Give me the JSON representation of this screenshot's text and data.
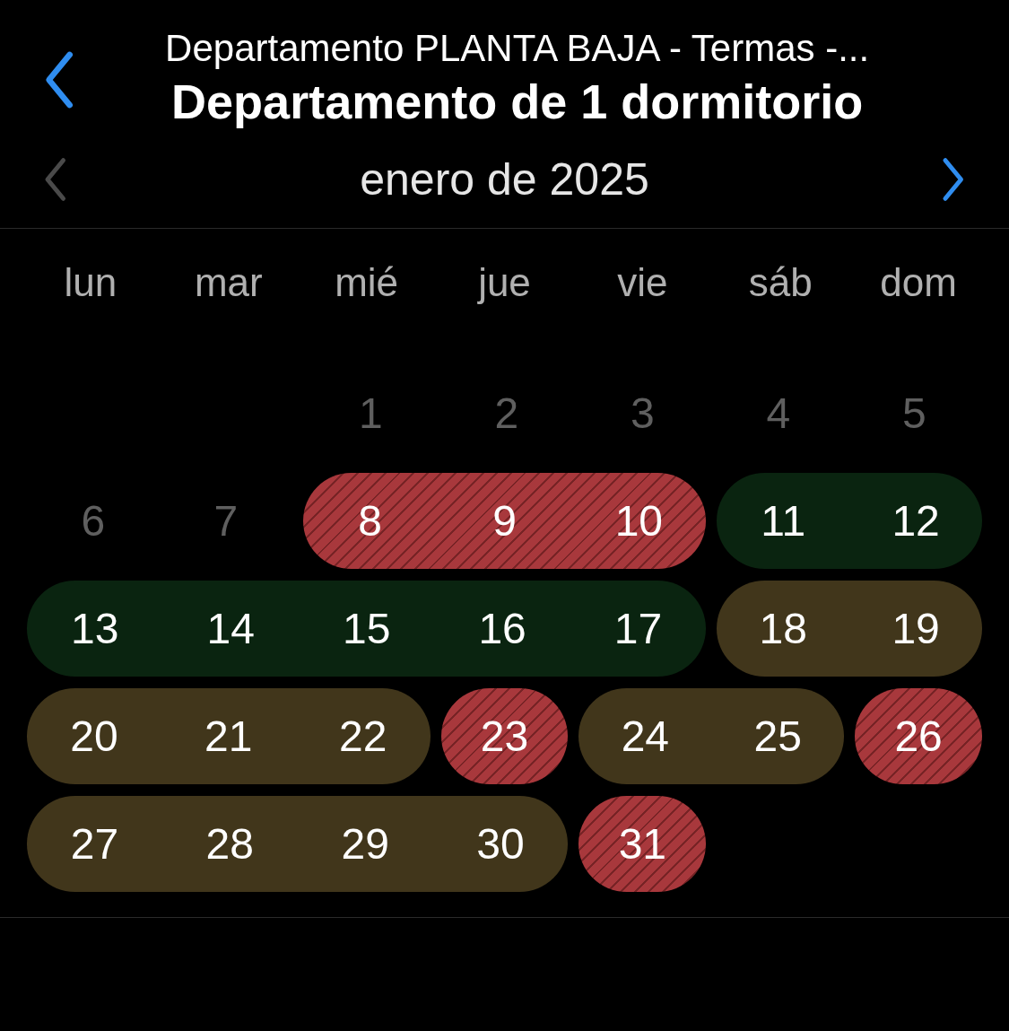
{
  "header": {
    "subtitle": "Departamento PLANTA BAJA - Termas -...",
    "title": "Departamento de 1 dormitorio"
  },
  "month_nav": {
    "label": "enero de 2025",
    "prev_disabled": true,
    "next_disabled": false
  },
  "weekdays": [
    "lun",
    "mar",
    "mié",
    "jue",
    "vie",
    "sáb",
    "dom"
  ],
  "weeks": [
    {
      "segments": [
        {
          "kind": "plain",
          "days": [
            "1",
            "2",
            "3",
            "4",
            "5"
          ]
        }
      ]
    },
    {
      "segments": [
        {
          "kind": "plain",
          "days": [
            "6",
            "7"
          ]
        },
        {
          "kind": "booked",
          "days": [
            "8",
            "9",
            "10"
          ]
        },
        {
          "kind": "available",
          "days": [
            "11",
            "12"
          ]
        }
      ]
    },
    {
      "segments": [
        {
          "kind": "available",
          "days": [
            "13",
            "14",
            "15",
            "16",
            "17"
          ]
        },
        {
          "kind": "pending",
          "days": [
            "18",
            "19"
          ]
        }
      ]
    },
    {
      "segments": [
        {
          "kind": "pending",
          "days": [
            "20",
            "21",
            "22"
          ]
        },
        {
          "kind": "booked",
          "days": [
            "23"
          ]
        },
        {
          "kind": "pending",
          "days": [
            "24",
            "25"
          ]
        },
        {
          "kind": "booked",
          "days": [
            "26"
          ]
        }
      ]
    },
    {
      "segments": [
        {
          "kind": "pending",
          "days": [
            "27",
            "28",
            "29",
            "30"
          ]
        },
        {
          "kind": "booked",
          "days": [
            "31"
          ]
        }
      ]
    }
  ]
}
